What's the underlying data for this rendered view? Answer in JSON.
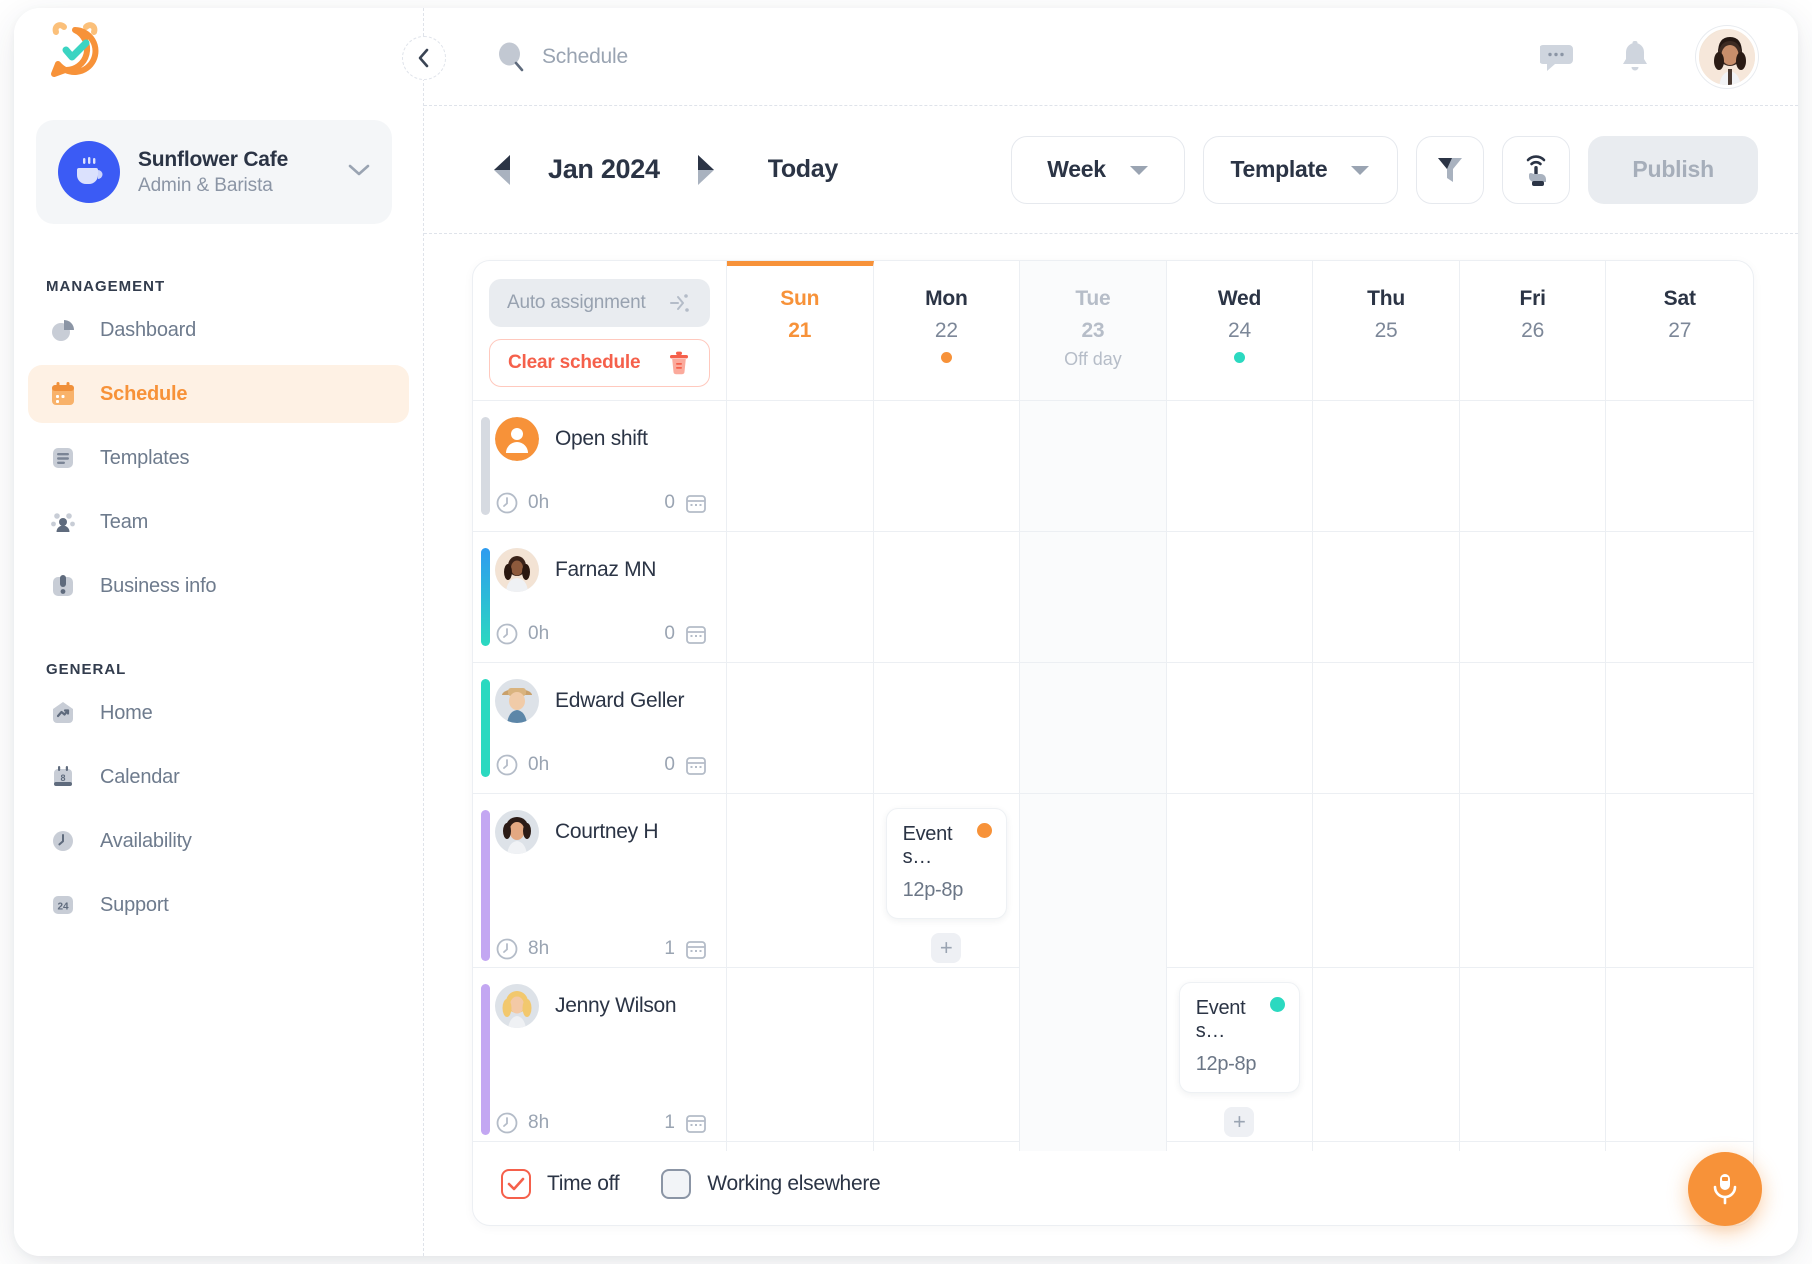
{
  "brand": {
    "logo_icon": "alarm-clock-check-icon",
    "accent_orange": "#F79239",
    "accent_teal": "#2BD9C0",
    "accent_red": "#F5604B",
    "accent_blue": "#3B5BF5"
  },
  "org": {
    "name": "Sunflower Cafe",
    "role": "Admin & Barista",
    "avatar_icon": "coffee-cup-icon",
    "chevron_icon": "chevron-down-icon"
  },
  "sidebar": {
    "sections": [
      {
        "label": "MANAGEMENT",
        "items": [
          {
            "label": "Dashboard",
            "icon": "pie-chart-icon",
            "active": false
          },
          {
            "label": "Schedule",
            "icon": "calendar-icon",
            "active": true
          },
          {
            "label": "Templates",
            "icon": "document-list-icon",
            "active": false
          },
          {
            "label": "Team",
            "icon": "people-group-icon",
            "active": false
          },
          {
            "label": "Business info",
            "icon": "briefcase-icon",
            "active": false
          }
        ]
      },
      {
        "label": "GENERAL",
        "items": [
          {
            "label": "Home",
            "icon": "house-trend-icon",
            "active": false
          },
          {
            "label": "Calendar",
            "icon": "calendar-8-icon",
            "active": false
          },
          {
            "label": "Availability",
            "icon": "clock-icon",
            "active": false
          },
          {
            "label": "Support",
            "icon": "support-24-icon",
            "active": false
          }
        ]
      }
    ]
  },
  "topbar": {
    "collapse_icon": "chevron-left-icon",
    "search_icon": "search-icon",
    "search_placeholder": "Schedule",
    "messages_icon": "chat-bubble-icon",
    "notifications_icon": "bell-icon",
    "avatar_icon": "user-avatar"
  },
  "toolbar": {
    "prev_icon": "caret-left-icon",
    "next_icon": "caret-right-icon",
    "month_label": "Jan 2024",
    "today_label": "Today",
    "view_select": {
      "label": "Week",
      "icon": "chevron-down-icon"
    },
    "template_select": {
      "label": "Template",
      "icon": "chevron-down-icon"
    },
    "filter_icon": "funnel-filter-icon",
    "broadcast_icon": "tap-broadcast-icon",
    "publish_label": "Publish"
  },
  "schedule": {
    "auto_assign_label": "Auto assignment",
    "auto_assign_icon": "magic-wand-icon",
    "clear_label": "Clear schedule",
    "clear_icon": "trash-icon",
    "days": [
      {
        "dow": "Sun",
        "num": "21",
        "today": true,
        "offday": false,
        "offlabel": "",
        "dot": ""
      },
      {
        "dow": "Mon",
        "num": "22",
        "today": false,
        "offday": false,
        "offlabel": "",
        "dot": "#F79239"
      },
      {
        "dow": "Tue",
        "num": "23",
        "today": false,
        "offday": true,
        "offlabel": "Off day",
        "dot": ""
      },
      {
        "dow": "Wed",
        "num": "24",
        "today": false,
        "offday": false,
        "offlabel": "",
        "dot": "#2BD9C0"
      },
      {
        "dow": "Thu",
        "num": "25",
        "today": false,
        "offday": false,
        "offlabel": "",
        "dot": ""
      },
      {
        "dow": "Fri",
        "num": "26",
        "today": false,
        "offday": false,
        "offlabel": "",
        "dot": ""
      },
      {
        "dow": "Sat",
        "num": "27",
        "today": false,
        "offday": false,
        "offlabel": "",
        "dot": ""
      }
    ],
    "rows": [
      {
        "name": "Open shift",
        "avatar": "open-shift-icon",
        "accent": "#D6DAE1",
        "hours": "0h",
        "shift_count": "0",
        "clock_icon": "clock-icon",
        "calendar_icon": "calendar-icon",
        "events": [
          null,
          null,
          null,
          null,
          null,
          null,
          null
        ],
        "add_buttons": [
          false,
          false,
          false,
          false,
          false,
          false,
          false
        ]
      },
      {
        "name": "Farnaz MN",
        "avatar": "avatar-farnaz",
        "accent": "linear-gradient(180deg,#2E9BF0 0%,#2BD9C0 100%)",
        "hours": "0h",
        "shift_count": "0",
        "clock_icon": "clock-icon",
        "calendar_icon": "calendar-icon",
        "events": [
          null,
          null,
          null,
          null,
          null,
          null,
          null
        ],
        "add_buttons": [
          false,
          false,
          false,
          false,
          false,
          false,
          false
        ]
      },
      {
        "name": "Edward Geller",
        "avatar": "avatar-edward",
        "accent": "#2BD9C0",
        "hours": "0h",
        "shift_count": "0",
        "clock_icon": "clock-icon",
        "calendar_icon": "calendar-icon",
        "events": [
          null,
          null,
          null,
          null,
          null,
          null,
          null
        ],
        "add_buttons": [
          false,
          false,
          false,
          false,
          false,
          false,
          false
        ]
      },
      {
        "name": "Courtney H",
        "avatar": "avatar-courtney",
        "accent": "#C3A7F2",
        "hours": "8h",
        "shift_count": "1",
        "clock_icon": "clock-icon",
        "calendar_icon": "calendar-icon",
        "events": [
          null,
          {
            "title": "Event s…",
            "time": "12p-8p",
            "dot": "#F79239"
          },
          null,
          null,
          null,
          null,
          null
        ],
        "add_buttons": [
          false,
          true,
          false,
          false,
          false,
          false,
          false
        ]
      },
      {
        "name": "Jenny Wilson",
        "avatar": "avatar-jenny",
        "accent": "#C3A7F2",
        "hours": "8h",
        "shift_count": "1",
        "clock_icon": "clock-icon",
        "calendar_icon": "calendar-icon",
        "events": [
          null,
          null,
          null,
          {
            "title": "Event s…",
            "time": "12p-8p",
            "dot": "#2BD9C0"
          },
          null,
          null,
          null
        ],
        "add_buttons": [
          false,
          false,
          false,
          true,
          false,
          false,
          false
        ]
      }
    ],
    "legend": [
      {
        "label": "Time off",
        "icon": "checkbox-checked-red-icon"
      },
      {
        "label": "Working elsewhere",
        "icon": "checkbox-hatched-icon"
      }
    ],
    "add_icon": "plus-icon"
  },
  "fab": {
    "icon": "microphone-icon"
  }
}
